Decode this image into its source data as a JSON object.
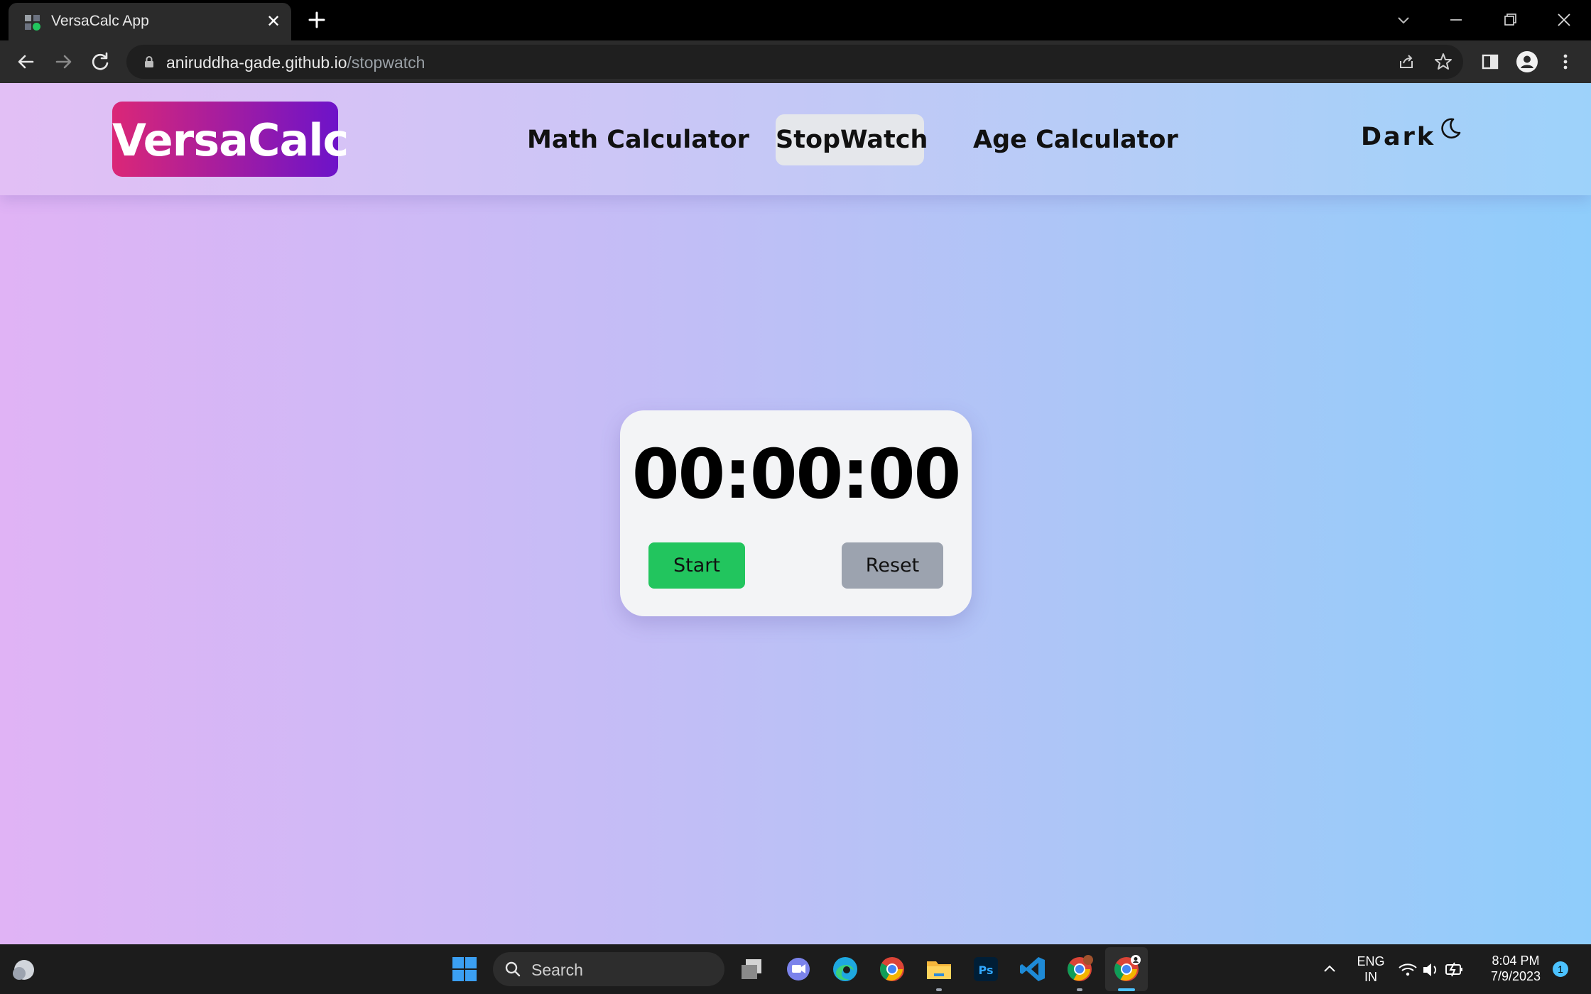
{
  "browser": {
    "tab_title": "VersaCalc App",
    "tab_close": "✕",
    "url_host": "aniruddha-gade.github.io",
    "url_path": "/stopwatch"
  },
  "app": {
    "logo": "VersaCalc",
    "nav": [
      {
        "label": "Math Calculator"
      },
      {
        "label": "StopWatch",
        "active": true
      },
      {
        "label": "Age Calculator"
      }
    ],
    "theme_toggle_label": "Dark"
  },
  "stopwatch": {
    "time": "00:00:00",
    "start_label": "Start",
    "reset_label": "Reset"
  },
  "taskbar": {
    "search_placeholder": "Search",
    "lang_line1": "ENG",
    "lang_line2": "IN",
    "time": "8:04 PM",
    "date": "7/9/2023",
    "notification_count": "1"
  },
  "colors": {
    "logo_gradient_start": "#db2777",
    "logo_gradient_end": "#6d13c9",
    "start_button": "#22c55e",
    "reset_button": "#9ca3af",
    "active_nav_bg": "#e5e7eb"
  }
}
